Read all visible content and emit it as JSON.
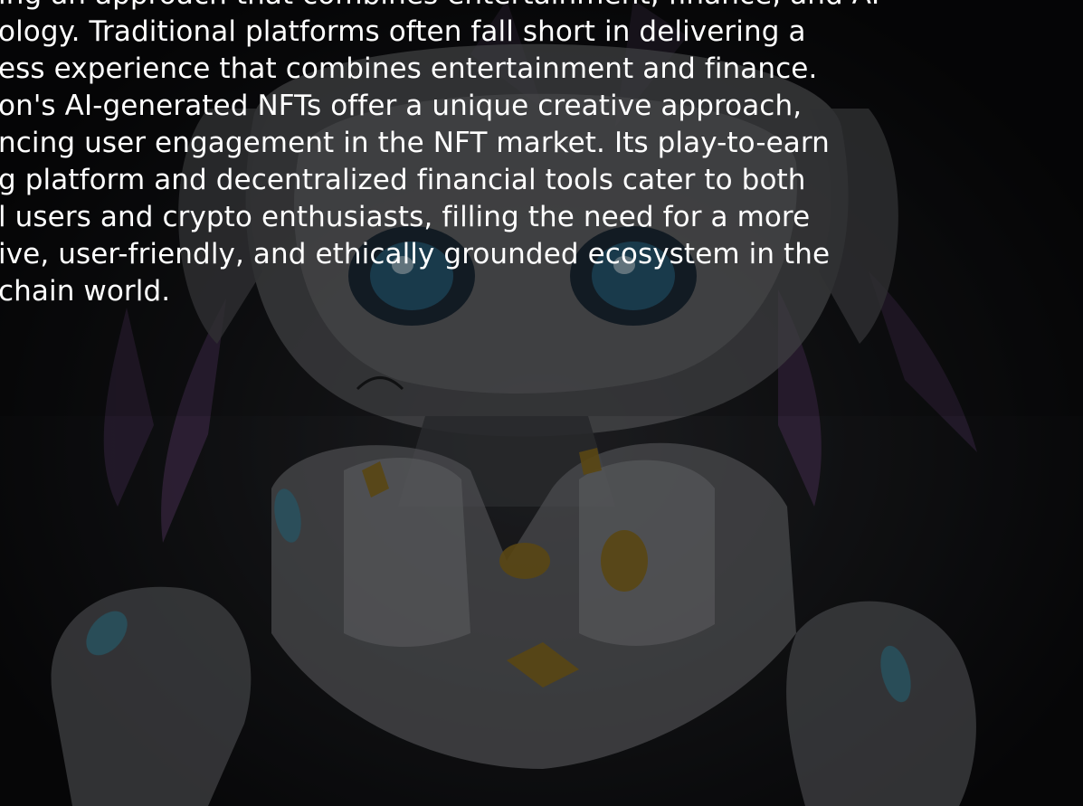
{
  "body_text": {
    "lines": [
      "ing an approach that combines entertainment, finance, and AI",
      "ology. Traditional platforms often fall short in delivering a",
      "ess experience that combines entertainment and finance.",
      "on's AI-generated NFTs offer a unique creative approach,",
      "ncing user engagement in the NFT market. Its play-to-earn",
      "g platform and decentralized financial tools cater to both",
      "l users and crypto enthusiasts, filling the need for a more",
      "ive, user-friendly, and ethically grounded ecosystem in the",
      "chain world."
    ]
  },
  "background": {
    "subject": "anime-style white robot character with purple hair, blue eyes and gold accents",
    "overlay_color": "#000000"
  }
}
